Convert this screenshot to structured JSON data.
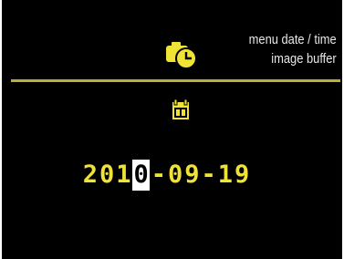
{
  "header": {
    "menu_label": "menu date / time",
    "submenu_label": "image buffer",
    "icon": "clock-camera-icon"
  },
  "date_editor": {
    "icon": "calendar-icon",
    "year_prefix": "201",
    "year_selected_digit": "0",
    "month_day": "-09-19"
  },
  "colors": {
    "background": "#000000",
    "accent": "#f0e336",
    "divider": "#b8b03a",
    "selected_bg": "#ffffff",
    "label_text": "#e8e8e8"
  }
}
